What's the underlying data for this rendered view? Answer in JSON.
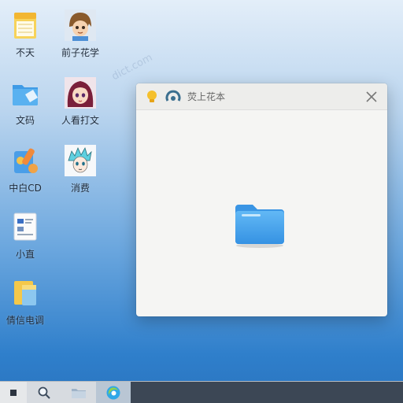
{
  "desktop": {
    "icons": [
      {
        "label": "不天",
        "icon": "notepad-icon"
      },
      {
        "label": "文码",
        "icon": "folder-icon"
      },
      {
        "label": "中白CD",
        "icon": "paint-tools-icon"
      },
      {
        "label": "小直",
        "icon": "document-icon"
      },
      {
        "label": "倩信电调",
        "icon": "folder-yellow-icon"
      },
      {
        "label": "前子花学",
        "icon": "anime-boy-avatar-icon"
      },
      {
        "label": "人看打文",
        "icon": "anime-girl-avatar-icon"
      },
      {
        "label": "消费",
        "icon": "anime-character-avatar-icon"
      }
    ]
  },
  "window": {
    "title": "荧上花本",
    "close_icon": "close-icon"
  },
  "watermarks": [
    "dict.com",
    "dict.com",
    "dict.com"
  ],
  "taskbar": {
    "items": [
      "start-icon",
      "search-icon",
      "file-explorer-icon",
      "browser-icon"
    ]
  },
  "colors": {
    "folder_blue": "#4aa3ea",
    "accent": "#2f7fcb"
  }
}
